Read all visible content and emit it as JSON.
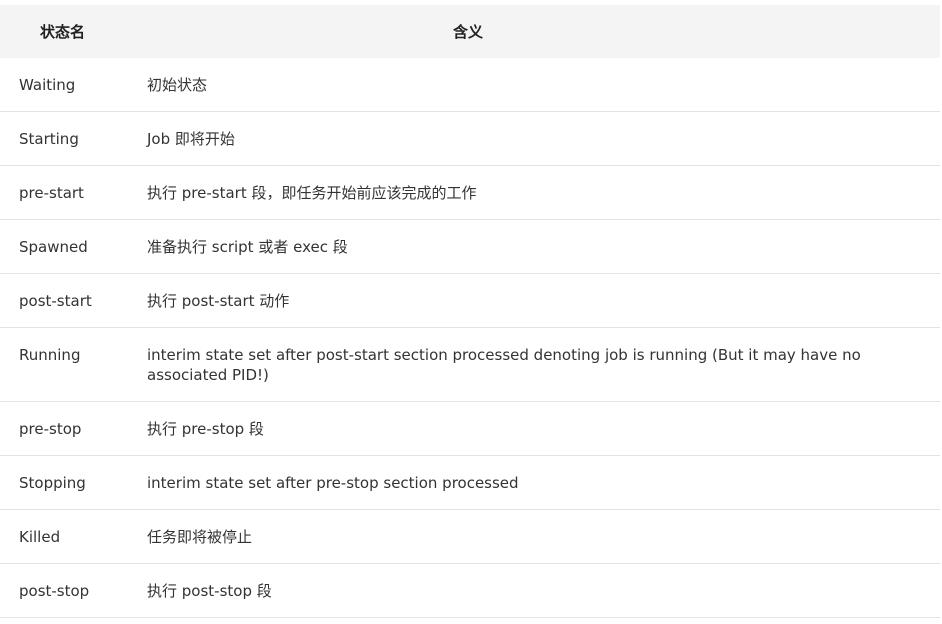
{
  "table": {
    "headers": {
      "state_name": "状态名",
      "meaning": "含义"
    },
    "rows": [
      {
        "state": "Waiting",
        "meaning": "初始状态"
      },
      {
        "state": "Starting",
        "meaning": "Job 即将开始"
      },
      {
        "state": "pre-start",
        "meaning": "执行 pre-start 段，即任务开始前应该完成的工作"
      },
      {
        "state": "Spawned",
        "meaning": "准备执行 script 或者 exec 段"
      },
      {
        "state": "post-start",
        "meaning": "执行 post-start 动作"
      },
      {
        "state": "Running",
        "meaning": "interim state set after post-start section processed denoting job is running (But it may have no associated PID!)"
      },
      {
        "state": "pre-stop",
        "meaning": "执行 pre-stop 段"
      },
      {
        "state": "Stopping",
        "meaning": "interim state set after pre-stop section processed"
      },
      {
        "state": "Killed",
        "meaning": "任务即将被停止"
      },
      {
        "state": "post-stop",
        "meaning": "执行 post-stop 段"
      }
    ]
  }
}
